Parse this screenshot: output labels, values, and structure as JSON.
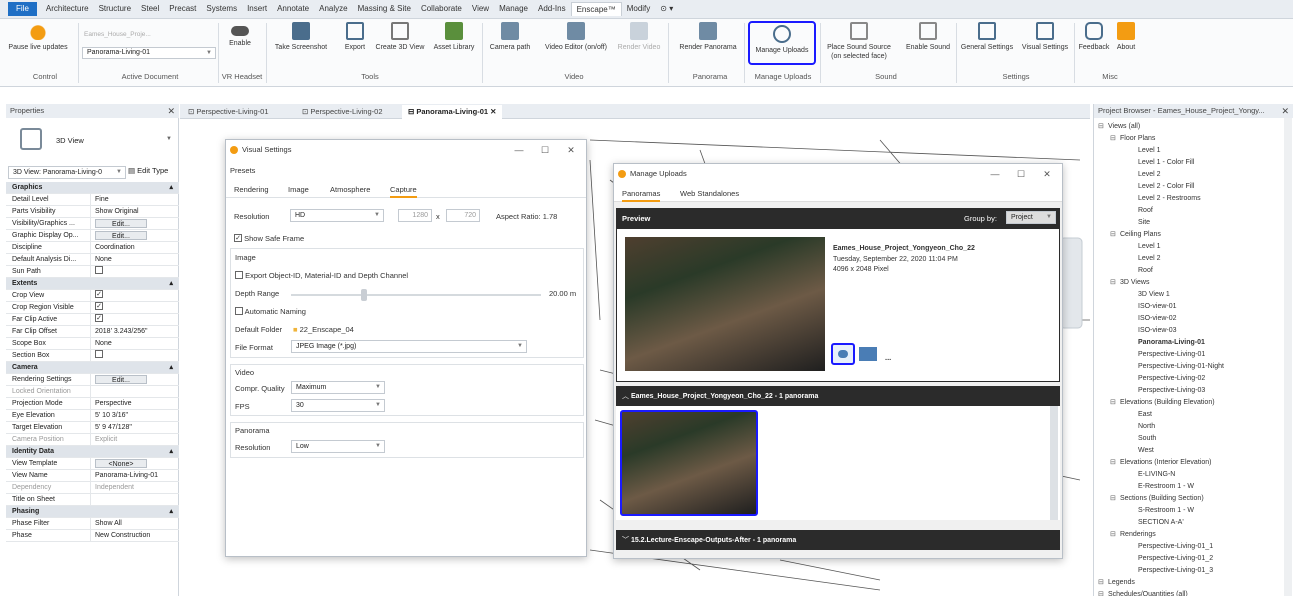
{
  "menubar": {
    "tabs": [
      "File",
      "Architecture",
      "Structure",
      "Steel",
      "Precast",
      "Systems",
      "Insert",
      "Annotate",
      "Analyze",
      "Massing & Site",
      "Collaborate",
      "View",
      "Manage",
      "Add-Ins",
      "Enscape™",
      "Modify",
      "⊙ ▾"
    ]
  },
  "ribbon": {
    "pause_live_updates": "Pause live updates",
    "active_document_value": "Panorama-Living-01",
    "active_document_hint": "Eames_House_Proje...",
    "enable": "Enable",
    "take_screenshot": "Take Screenshot",
    "export": "Export",
    "create_3d_view": "Create 3D View",
    "asset_library": "Asset Library",
    "camera_path": "Camera path",
    "video_editor": "Video Editor (on/off)",
    "render_video": "Render Video",
    "render_panorama": "Render Panorama",
    "manage_uploads": "Manage Uploads",
    "place_sound_source": "Place Sound Source (on selected face)",
    "enable_sound": "Enable Sound",
    "general_settings": "General Settings",
    "visual_settings": "Visual Settings",
    "feedback": "Feedback",
    "about": "About",
    "groups": {
      "control": "Control",
      "active_document": "Active Document",
      "vr_headset": "VR Headset",
      "tools": "Tools",
      "video": "Video",
      "panorama": "Panorama",
      "manage_uploads": "Manage Uploads",
      "sound": "Sound",
      "settings": "Settings",
      "misc": "Misc"
    }
  },
  "properties": {
    "title": "Properties",
    "type_name": "3D View",
    "selector": "3D View: Panorama-Living-0",
    "edit_type": "Edit Type",
    "rows": [
      {
        "k": "Graphics",
        "v": "",
        "sec": true
      },
      {
        "k": "Detail Level",
        "v": "Fine"
      },
      {
        "k": "Parts Visibility",
        "v": "Show Original"
      },
      {
        "k": "Visibility/Graphics ...",
        "v": "Edit...",
        "btn": true
      },
      {
        "k": "Graphic Display Op...",
        "v": "Edit...",
        "btn": true
      },
      {
        "k": "Discipline",
        "v": "Coordination"
      },
      {
        "k": "Default Analysis Di...",
        "v": "None"
      },
      {
        "k": "Sun Path",
        "v": "",
        "cb": false
      },
      {
        "k": "Extents",
        "v": "",
        "sec": true
      },
      {
        "k": "Crop View",
        "v": "",
        "cb": true
      },
      {
        "k": "Crop Region Visible",
        "v": "",
        "cb": true
      },
      {
        "k": "Far Clip Active",
        "v": "",
        "cb": true
      },
      {
        "k": "Far Clip Offset",
        "v": "2018' 3.243/256\""
      },
      {
        "k": "Scope Box",
        "v": "None"
      },
      {
        "k": "Section Box",
        "v": "",
        "cb": false
      },
      {
        "k": "Camera",
        "v": "",
        "sec": true
      },
      {
        "k": "Rendering Settings",
        "v": "Edit...",
        "btn": true
      },
      {
        "k": "Locked Orientation",
        "v": "",
        "grey": true
      },
      {
        "k": "Projection Mode",
        "v": "Perspective"
      },
      {
        "k": "Eye Elevation",
        "v": "5' 10 3/16\""
      },
      {
        "k": "Target Elevation",
        "v": "5' 9 47/128\""
      },
      {
        "k": "Camera Position",
        "v": "Explicit",
        "grey": true
      },
      {
        "k": "Identity Data",
        "v": "",
        "sec": true
      },
      {
        "k": "View Template",
        "v": "<None>",
        "btn": true
      },
      {
        "k": "View Name",
        "v": "Panorama-Living-01"
      },
      {
        "k": "Dependency",
        "v": "Independent",
        "grey": true
      },
      {
        "k": "Title on Sheet",
        "v": ""
      },
      {
        "k": "Phasing",
        "v": "",
        "sec": true
      },
      {
        "k": "Phase Filter",
        "v": "Show All"
      },
      {
        "k": "Phase",
        "v": "New Construction"
      }
    ]
  },
  "view_tabs": [
    "Perspective-Living-01",
    "Perspective-Living-02",
    "Panorama-Living-01"
  ],
  "visual_settings": {
    "title": "Visual Settings",
    "presets": "Presets",
    "tabs": [
      "Rendering",
      "Image",
      "Atmosphere",
      "Capture"
    ],
    "resolution_label": "Resolution",
    "resolution_value": "HD",
    "width": "1280",
    "x": "x",
    "height": "720",
    "aspect": "Aspect Ratio: 1.78",
    "show_safe_frame": "Show Safe Frame",
    "image_section": "Image",
    "export_channels": "Export Object-ID, Material-ID and Depth Channel",
    "depth_range": "Depth Range",
    "depth_value": "20.00 m",
    "auto_naming": "Automatic Naming",
    "default_folder": "Default Folder",
    "folder_value": "22_Enscape_04",
    "file_format": "File Format",
    "file_format_value": "JPEG Image (*.jpg)",
    "video_section": "Video",
    "compr_quality": "Compr. Quality",
    "compr_value": "Maximum",
    "fps": "FPS",
    "fps_value": "30",
    "panorama_section": "Panorama",
    "pano_resolution": "Resolution",
    "pano_resolution_value": "Low"
  },
  "manage_uploads": {
    "title": "Manage Uploads",
    "tabs": [
      "Panoramas",
      "Web Standalones"
    ],
    "preview": "Preview",
    "group_by": "Group by:",
    "group_by_value": "Project",
    "item_title": "Eames_House_Project_Yongyeon_Cho_22",
    "item_date": "Tuesday, September 22, 2020 11:04 PM",
    "item_size": "4096 x 2048 Pixel",
    "more": "...",
    "group1": "Eames_House_Project_Yongyeon_Cho_22 - 1 panorama",
    "group2": "15.2.Lecture-Enscape-Outputs-After - 1 panorama"
  },
  "project_browser": {
    "title": "Project Browser - Eames_House_Project_Yongy...",
    "nodes": [
      {
        "t": "Views (all)",
        "l": 0
      },
      {
        "t": "Floor Plans",
        "l": 1
      },
      {
        "t": "Level 1",
        "l": 2
      },
      {
        "t": "Level 1 - Color Fill",
        "l": 2
      },
      {
        "t": "Level 2",
        "l": 2
      },
      {
        "t": "Level 2 - Color Fill",
        "l": 2
      },
      {
        "t": "Level 2 - Restrooms",
        "l": 2
      },
      {
        "t": "Roof",
        "l": 2
      },
      {
        "t": "Site",
        "l": 2
      },
      {
        "t": "Ceiling Plans",
        "l": 1
      },
      {
        "t": "Level 1",
        "l": 2
      },
      {
        "t": "Level 2",
        "l": 2
      },
      {
        "t": "Roof",
        "l": 2
      },
      {
        "t": "3D Views",
        "l": 1
      },
      {
        "t": "3D View 1",
        "l": 2
      },
      {
        "t": "ISO-view-01",
        "l": 2
      },
      {
        "t": "ISO-view-02",
        "l": 2
      },
      {
        "t": "ISO-view-03",
        "l": 2
      },
      {
        "t": "Panorama-Living-01",
        "l": 2,
        "b": true
      },
      {
        "t": "Perspective-Living-01",
        "l": 2
      },
      {
        "t": "Perspective-Living-01-Night",
        "l": 2
      },
      {
        "t": "Perspective-Living-02",
        "l": 2
      },
      {
        "t": "Perspective-Living-03",
        "l": 2
      },
      {
        "t": "Elevations (Building Elevation)",
        "l": 1
      },
      {
        "t": "East",
        "l": 2
      },
      {
        "t": "North",
        "l": 2
      },
      {
        "t": "South",
        "l": 2
      },
      {
        "t": "West",
        "l": 2
      },
      {
        "t": "Elevations (Interior Elevation)",
        "l": 1
      },
      {
        "t": "E-LIVING-N",
        "l": 2
      },
      {
        "t": "E-Restroom 1 - W",
        "l": 2
      },
      {
        "t": "Sections (Building Section)",
        "l": 1
      },
      {
        "t": "S-Restroom 1 - W",
        "l": 2
      },
      {
        "t": "SECTION A-A'",
        "l": 2
      },
      {
        "t": "Renderings",
        "l": 1
      },
      {
        "t": "Perspective-Living-01_1",
        "l": 2
      },
      {
        "t": "Perspective-Living-01_2",
        "l": 2
      },
      {
        "t": "Perspective-Living-01_3",
        "l": 2
      },
      {
        "t": "Legends",
        "l": 0
      },
      {
        "t": "Schedules/Quantities (all)",
        "l": 0
      }
    ]
  },
  "colors": {
    "accent": "#1f6fc5",
    "highlight": "#1a1aff",
    "enscape_orange": "#f39c12",
    "dark_panel": "#2b2b2b"
  }
}
